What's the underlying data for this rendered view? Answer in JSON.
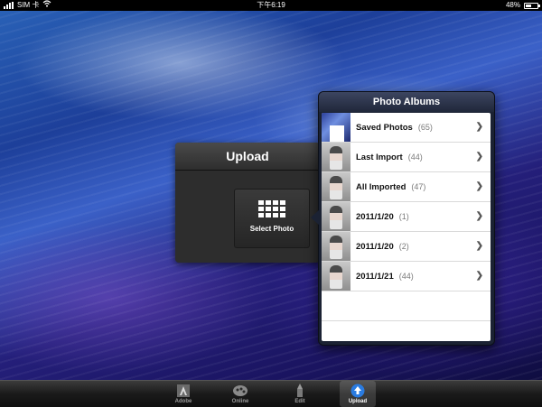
{
  "status_bar": {
    "carrier": "SIM 卡",
    "time": "下午6:19",
    "battery": "48%",
    "battery_level": 0.48
  },
  "upload_panel": {
    "title": "Upload",
    "select_photo_label": "Select Photo"
  },
  "photo_albums": {
    "title": "Photo Albums",
    "albums": [
      {
        "name": "Saved Photos",
        "count": "(65)"
      },
      {
        "name": "Last Import",
        "count": "(44)"
      },
      {
        "name": "All Imported",
        "count": "(47)"
      },
      {
        "name": "2011/1/20",
        "count": "(1)"
      },
      {
        "name": "2011/1/20",
        "count": "(2)"
      },
      {
        "name": "2011/1/21",
        "count": "(44)"
      }
    ]
  },
  "tab_bar": {
    "tabs": [
      {
        "label": "Adobe",
        "icon": "adobe-icon",
        "active": false
      },
      {
        "label": "Online",
        "icon": "online-icon",
        "active": false
      },
      {
        "label": "Edit",
        "icon": "edit-icon",
        "active": false
      },
      {
        "label": "Upload",
        "icon": "upload-icon",
        "active": true
      }
    ]
  },
  "colors": {
    "tab_active": "#2a7be0",
    "panel_bg": "#2d2d2d"
  }
}
